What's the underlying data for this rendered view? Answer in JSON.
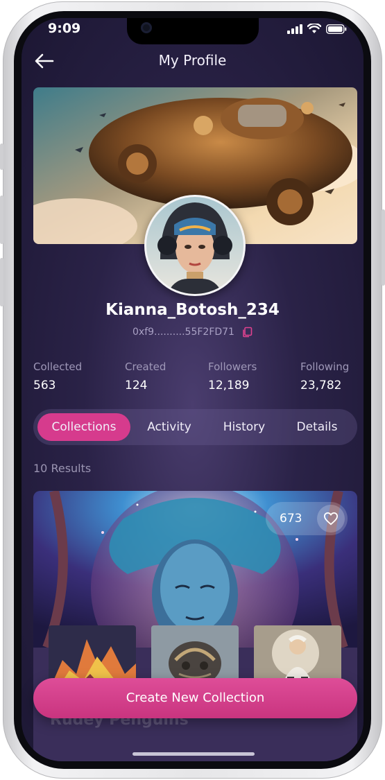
{
  "status_bar": {
    "time": "9:09"
  },
  "header": {
    "title": "My Profile",
    "back_icon": "arrow-left-icon"
  },
  "profile": {
    "username": "Kianna_Botosh_234",
    "wallet_address": "0xf9..........55F2FD71",
    "copy_icon": "copy-icon"
  },
  "stats": [
    {
      "label": "Collected",
      "value": "563"
    },
    {
      "label": "Created",
      "value": "124"
    },
    {
      "label": "Followers",
      "value": "12,189"
    },
    {
      "label": "Following",
      "value": "23,782"
    }
  ],
  "tabs": [
    {
      "label": "Collections",
      "active": true
    },
    {
      "label": "Activity",
      "active": false
    },
    {
      "label": "History",
      "active": false
    },
    {
      "label": "Details",
      "active": false
    }
  ],
  "results": {
    "count_text": "10 Results"
  },
  "collection_card": {
    "likes": "673",
    "heart_icon": "heart-icon",
    "title": "Rudey Penguins"
  },
  "actions": {
    "create_button_label": "Create New Collection"
  },
  "colors": {
    "accent": "#d63b8d",
    "background": "#2a2247"
  }
}
